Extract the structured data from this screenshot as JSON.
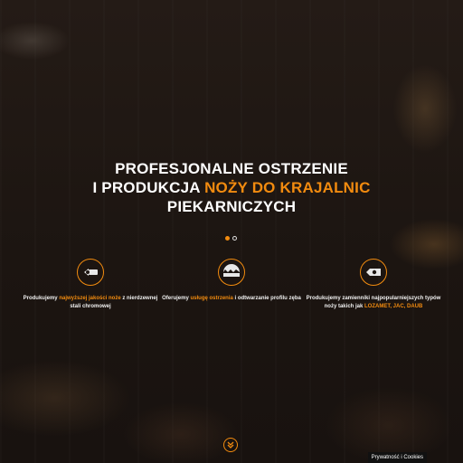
{
  "hero": {
    "line1": "PROFESJONALNE OSTRZENIE",
    "line2_prefix": "I PRODUKCJA ",
    "line2_accent": "NOŻY DO KRAJALNIC",
    "line3": "PIEKARNICZYCH"
  },
  "slider": {
    "dots": 2,
    "active": 1
  },
  "features": [
    {
      "icon": "knife-blade-icon",
      "pre": "Produkujemy ",
      "highlight": "najwyższej jakości noże",
      "post": " z nierdzewnej stali chromowej"
    },
    {
      "icon": "sharpening-icon",
      "pre": "Oferujemy ",
      "highlight": "usługę ostrzenia",
      "post": " i odtwarzanie profilu zęba"
    },
    {
      "icon": "replacement-blade-icon",
      "pre": "Produkujemy zamienniki najpopularniejszych typów noży takich jak ",
      "highlight": "LOZAMET, JAC, DAUB",
      "post": ""
    }
  ],
  "scroll": {
    "icon": "double-chevron-down-icon"
  },
  "cookies": {
    "label": "Prywatność i Cookies"
  },
  "colors": {
    "accent": "#f28b0f",
    "background": "#1d1612"
  }
}
